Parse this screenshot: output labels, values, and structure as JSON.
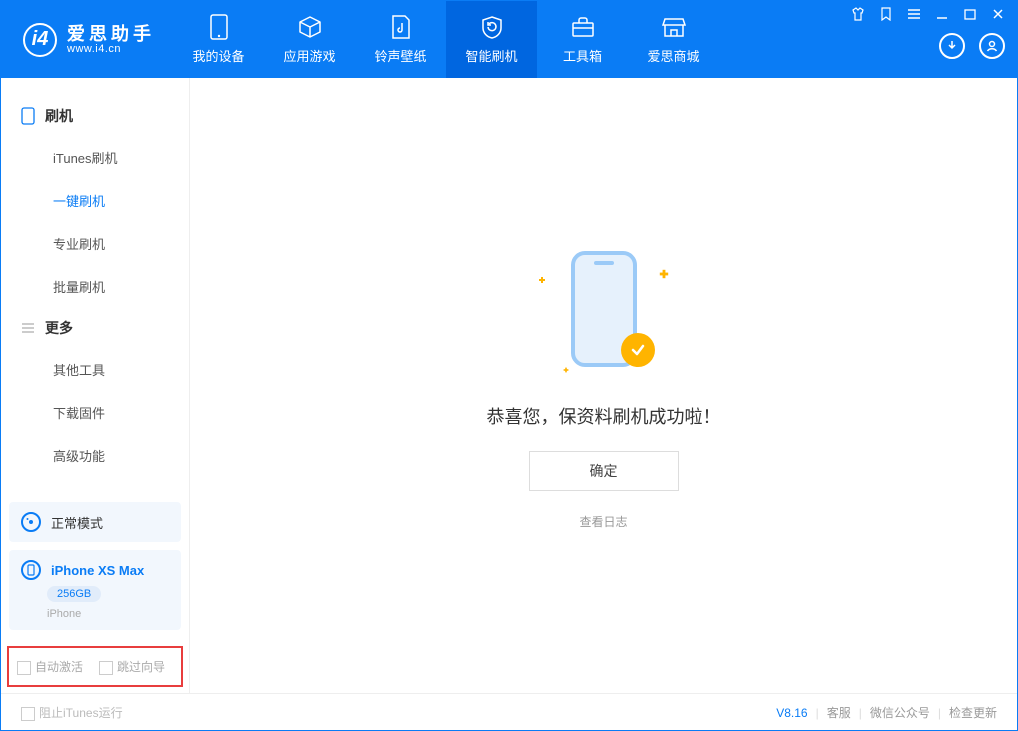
{
  "app": {
    "name_cn": "爱思助手",
    "url": "www.i4.cn"
  },
  "header": {
    "tabs": [
      {
        "label": "我的设备"
      },
      {
        "label": "应用游戏"
      },
      {
        "label": "铃声壁纸"
      },
      {
        "label": "智能刷机"
      },
      {
        "label": "工具箱"
      },
      {
        "label": "爱思商城"
      }
    ]
  },
  "sidebar": {
    "group1": {
      "title": "刷机",
      "items": [
        {
          "label": "iTunes刷机"
        },
        {
          "label": "一键刷机"
        },
        {
          "label": "专业刷机"
        },
        {
          "label": "批量刷机"
        }
      ]
    },
    "group2": {
      "title": "更多",
      "items": [
        {
          "label": "其他工具"
        },
        {
          "label": "下载固件"
        },
        {
          "label": "高级功能"
        }
      ]
    },
    "mode_label": "正常模式",
    "device": {
      "name": "iPhone XS Max",
      "capacity": "256GB",
      "type": "iPhone"
    },
    "options": {
      "auto_activate": "自动激活",
      "skip_guide": "跳过向导"
    }
  },
  "main": {
    "success_msg": "恭喜您，保资料刷机成功啦！",
    "ok_label": "确定",
    "log_link": "查看日志"
  },
  "footer": {
    "block_itunes": "阻止iTunes运行",
    "version": "V8.16",
    "links": [
      "客服",
      "微信公众号",
      "检查更新"
    ]
  }
}
